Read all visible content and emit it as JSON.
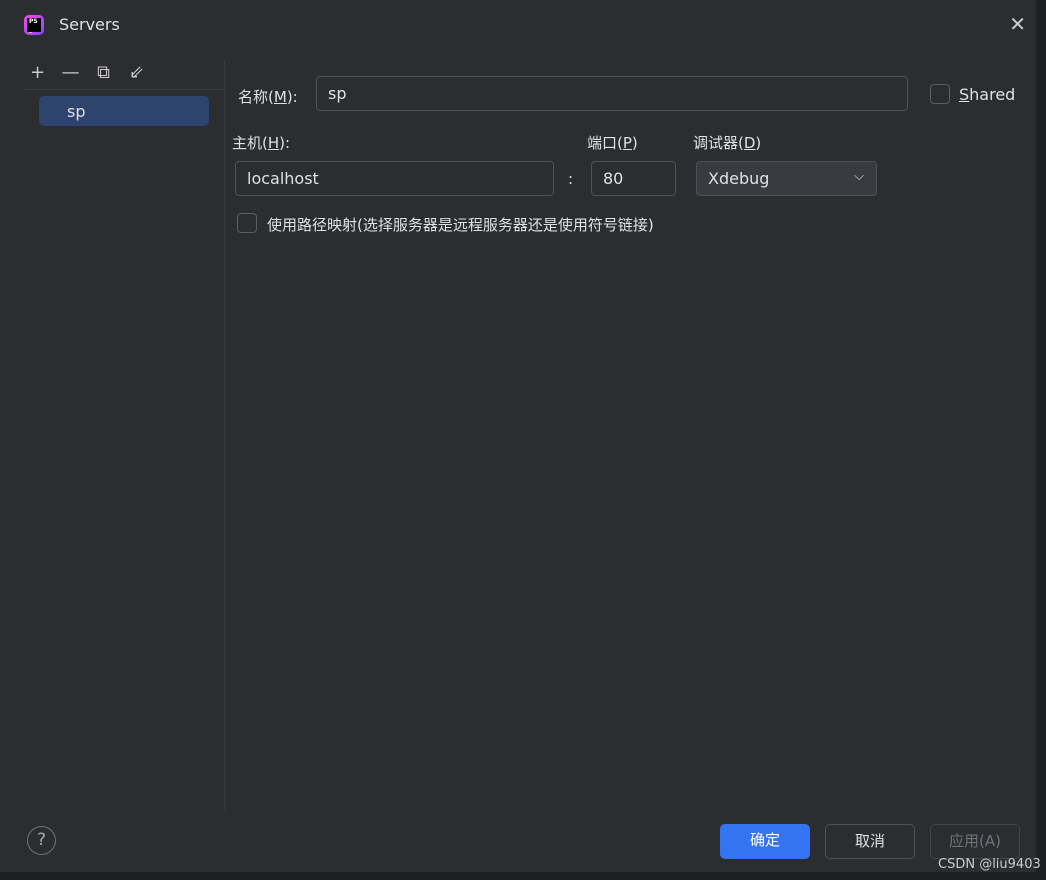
{
  "window": {
    "title": "Servers"
  },
  "toolbar": {
    "add": "+",
    "remove": "—",
    "copy": "⧉",
    "import": "⇙"
  },
  "servers": [
    {
      "name": "sp"
    }
  ],
  "form": {
    "name_label": {
      "pre": "名称(",
      "key": "M",
      "post": "):"
    },
    "name_value": "sp",
    "shared_label": {
      "key": "S",
      "post": "hared"
    },
    "shared_checked": false,
    "host_label": {
      "pre": "主机(",
      "key": "H",
      "post": "):"
    },
    "host_value": "localhost",
    "colon": ":",
    "port_label": {
      "pre": "端口(",
      "key": "P",
      "post": ")"
    },
    "port_value": "80",
    "debugger_label": {
      "pre": "调试器(",
      "key": "D",
      "post": ")"
    },
    "debugger_value": "Xdebug",
    "path_mapping_label": "使用路径映射(选择服务器是远程服务器还是使用符号链接)",
    "path_mapping_checked": false
  },
  "footer": {
    "help": "?",
    "ok": "确定",
    "cancel": "取消",
    "apply": "应用(A)"
  },
  "watermark": "CSDN @liu9403"
}
